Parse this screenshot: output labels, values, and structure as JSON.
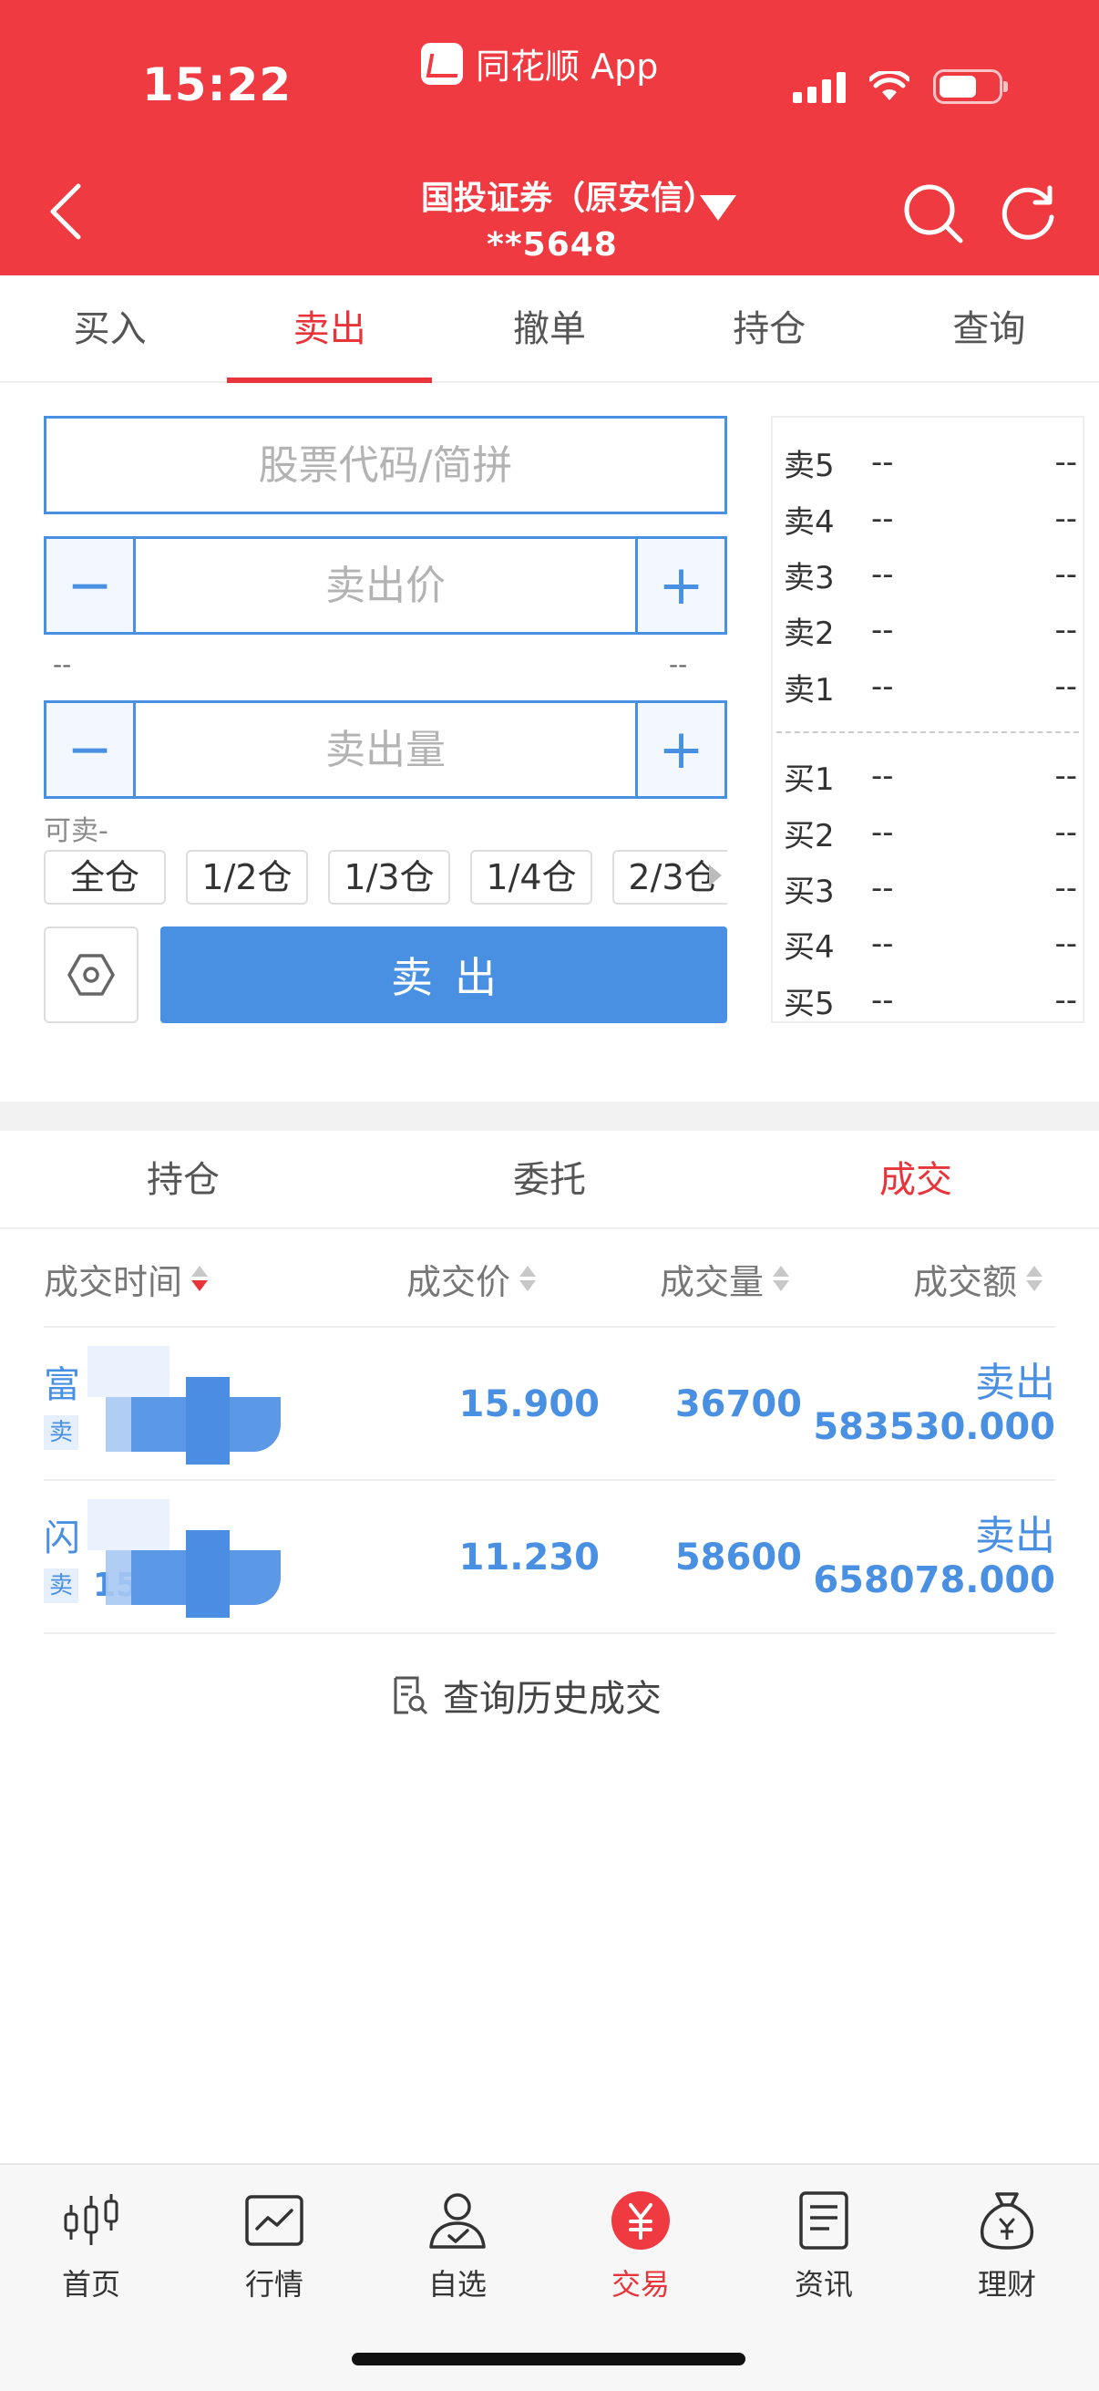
{
  "status_bar": {
    "time": "15:22",
    "app_label": "同花顺 App"
  },
  "header": {
    "account_name": "国投证券（原安信）",
    "account_number": "**5648"
  },
  "top_tabs": [
    {
      "label": "买入"
    },
    {
      "label": "卖出"
    },
    {
      "label": "撤单"
    },
    {
      "label": "持仓"
    },
    {
      "label": "查询"
    }
  ],
  "order_form": {
    "code_placeholder": "股票代码/简拼",
    "price_placeholder": "卖出价",
    "qty_placeholder": "卖出量",
    "minus": "−",
    "plus": "+",
    "limit_low": "--",
    "limit_high": "--",
    "sellable": "可卖-",
    "position_buttons": [
      "全仓",
      "1/2仓",
      "1/3仓",
      "1/4仓",
      "2/3仓"
    ],
    "sell_button": "卖出"
  },
  "order_book": {
    "asks": [
      {
        "label": "卖5",
        "price": "--",
        "volume": "--"
      },
      {
        "label": "卖4",
        "price": "--",
        "volume": "--"
      },
      {
        "label": "卖3",
        "price": "--",
        "volume": "--"
      },
      {
        "label": "卖2",
        "price": "--",
        "volume": "--"
      },
      {
        "label": "卖1",
        "price": "--",
        "volume": "--"
      }
    ],
    "bids": [
      {
        "label": "买1",
        "price": "--",
        "volume": "--"
      },
      {
        "label": "买2",
        "price": "--",
        "volume": "--"
      },
      {
        "label": "买3",
        "price": "--",
        "volume": "--"
      },
      {
        "label": "买4",
        "price": "--",
        "volume": "--"
      },
      {
        "label": "买5",
        "price": "--",
        "volume": "--"
      }
    ]
  },
  "sub_tabs": [
    {
      "label": "持仓"
    },
    {
      "label": "委托"
    },
    {
      "label": "成交"
    }
  ],
  "trades_table": {
    "columns": [
      "成交时间",
      "成交价",
      "成交量",
      "成交额"
    ],
    "rows": [
      {
        "name": "富",
        "side": "卖",
        "time": "",
        "price": "15.900",
        "qty": "36700",
        "direction": "卖出",
        "amount": "583530.000"
      },
      {
        "name": "闪",
        "side": "卖",
        "time": "15:",
        "price": "11.230",
        "qty": "58600",
        "direction": "卖出",
        "amount": "658078.000"
      }
    ],
    "history_link": "查询历史成交"
  },
  "bottom_nav": [
    {
      "label": "首页",
      "icon": "candlestick-icon"
    },
    {
      "label": "行情",
      "icon": "chart-icon"
    },
    {
      "label": "自选",
      "icon": "user-check-icon"
    },
    {
      "label": "交易",
      "icon": "yuan-icon"
    },
    {
      "label": "资讯",
      "icon": "document-icon"
    },
    {
      "label": "理财",
      "icon": "money-bag-icon"
    }
  ],
  "colors": {
    "brand_red": "#ef3a42",
    "accent_blue": "#4a90e2"
  }
}
